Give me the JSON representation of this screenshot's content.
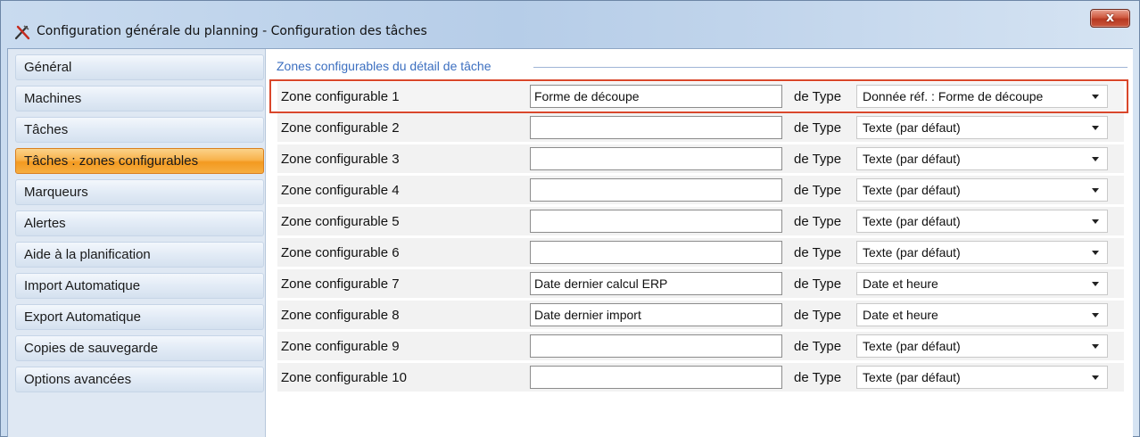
{
  "window": {
    "title": "Configuration générale du planning - Configuration des tâches",
    "app_icon": "tools-icon",
    "close_icon": "close-icon",
    "close_label": "x"
  },
  "sidebar": {
    "items": [
      {
        "label": "Général",
        "active": false
      },
      {
        "label": "Machines",
        "active": false
      },
      {
        "label": "Tâches",
        "active": false
      },
      {
        "label": "Tâches : zones configurables",
        "active": true
      },
      {
        "label": "Marqueurs",
        "active": false
      },
      {
        "label": "Alertes",
        "active": false
      },
      {
        "label": "Aide à la planification",
        "active": false
      },
      {
        "label": "Import Automatique",
        "active": false
      },
      {
        "label": "Export Automatique",
        "active": false
      },
      {
        "label": "Copies de sauvegarde",
        "active": false
      },
      {
        "label": "Options avancées",
        "active": false
      }
    ]
  },
  "main": {
    "group_title": "Zones configurables du détail de tâche",
    "type_prefix": "de Type",
    "rows": [
      {
        "label": "Zone configurable 1",
        "value": "Forme de découpe",
        "type": "Donnée réf. : Forme de découpe",
        "highlighted": true
      },
      {
        "label": "Zone configurable 2",
        "value": "",
        "type": "Texte (par défaut)",
        "highlighted": false
      },
      {
        "label": "Zone configurable 3",
        "value": "",
        "type": "Texte (par défaut)",
        "highlighted": false
      },
      {
        "label": "Zone configurable 4",
        "value": "",
        "type": "Texte (par défaut)",
        "highlighted": false
      },
      {
        "label": "Zone configurable 5",
        "value": "",
        "type": "Texte (par défaut)",
        "highlighted": false
      },
      {
        "label": "Zone configurable 6",
        "value": "",
        "type": "Texte (par défaut)",
        "highlighted": false
      },
      {
        "label": "Zone configurable 7",
        "value": "Date dernier calcul ERP",
        "type": "Date et heure",
        "highlighted": false
      },
      {
        "label": "Zone configurable 8",
        "value": "Date dernier import",
        "type": "Date et heure",
        "highlighted": false
      },
      {
        "label": "Zone configurable 9",
        "value": "",
        "type": "Texte (par défaut)",
        "highlighted": false
      },
      {
        "label": "Zone configurable 10",
        "value": "",
        "type": "Texte (par défaut)",
        "highlighted": false
      }
    ]
  },
  "colors": {
    "active_tab": "#f39a20",
    "highlight_border": "#d9472b",
    "group_title": "#3c6fc0"
  }
}
